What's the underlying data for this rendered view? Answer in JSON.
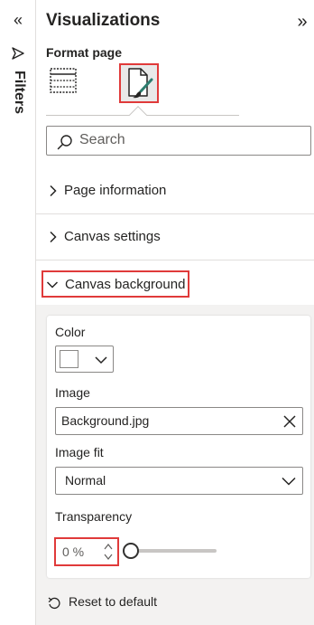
{
  "filters_rail": {
    "label": "Filters"
  },
  "panel": {
    "title": "Visualizations",
    "subtitle": "Format page"
  },
  "search": {
    "placeholder": "Search"
  },
  "sections": [
    {
      "label": "Page information",
      "expanded": false
    },
    {
      "label": "Canvas settings",
      "expanded": false
    },
    {
      "label": "Canvas background",
      "expanded": true
    }
  ],
  "canvas_background": {
    "color_label": "Color",
    "color_value": "#ffffff",
    "image_label": "Image",
    "image_value": "Background.jpg",
    "image_fit_label": "Image fit",
    "image_fit_value": "Normal",
    "transparency_label": "Transparency",
    "transparency_value": "0 %",
    "transparency_level": 0
  },
  "reset_label": "Reset to default",
  "colors": {
    "highlight": "#e03a3a",
    "section_bg": "#f3f2f1",
    "text": "#252423",
    "brush_accent": "#2d7d6f"
  }
}
